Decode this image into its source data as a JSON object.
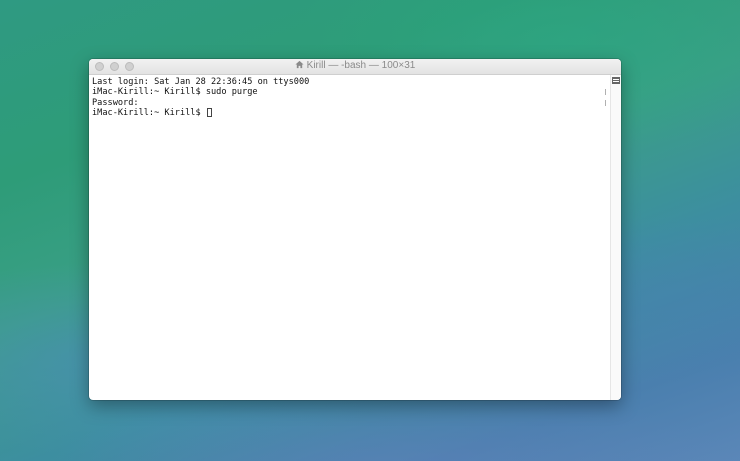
{
  "window": {
    "title": "Kirill — -bash — 100×31",
    "controls": [
      "close",
      "minimize",
      "zoom"
    ]
  },
  "terminal": {
    "lines": [
      "Last login: Sat Jan 28 22:36:45 on ttys000",
      "iMac-Kirill:~ Kirill$ sudo purge",
      "Password:",
      "iMac-Kirill:~ Kirill$ "
    ]
  },
  "icons": {
    "title_icon": "home-icon",
    "split_pane": "split-pane-icon"
  }
}
